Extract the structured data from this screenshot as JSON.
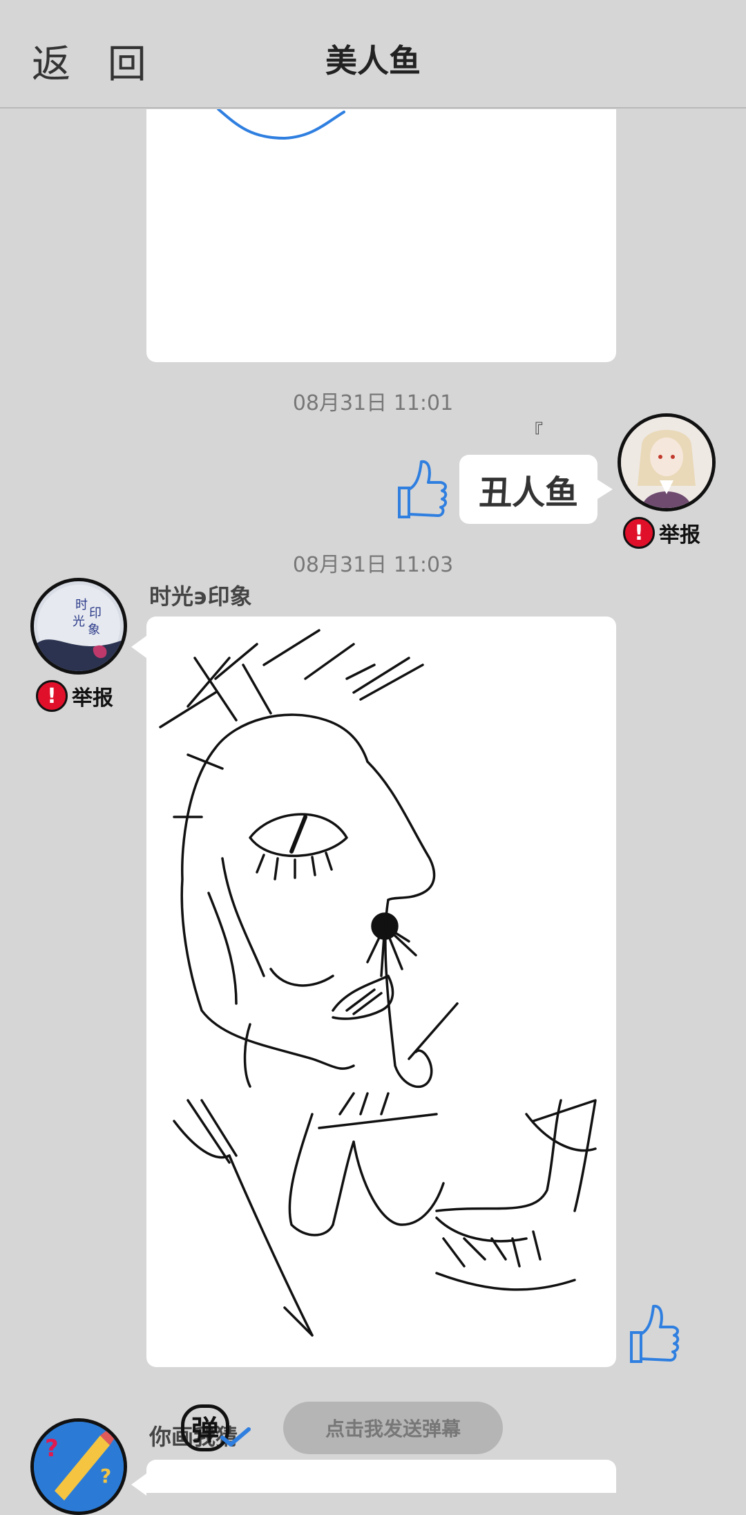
{
  "header": {
    "back_label": "返 回",
    "title": "美人鱼"
  },
  "messages": [
    {
      "timestamp": "08月31日  11:01",
      "text": "丑人鱼",
      "bracket_marks": "『 』",
      "report_label": "举报"
    },
    {
      "timestamp": "08月31日  11:03",
      "author": "时光϶印象",
      "report_label": "举报",
      "avatar_text": "时光印象"
    },
    {
      "author": "你画我猜"
    }
  ],
  "danmaku": {
    "toggle_label": "弹",
    "send_label": "点击我发送弹幕"
  },
  "colors": {
    "background": "#d6d6d6",
    "like_blue": "#2f7fe0",
    "report_red": "#e0102a"
  }
}
